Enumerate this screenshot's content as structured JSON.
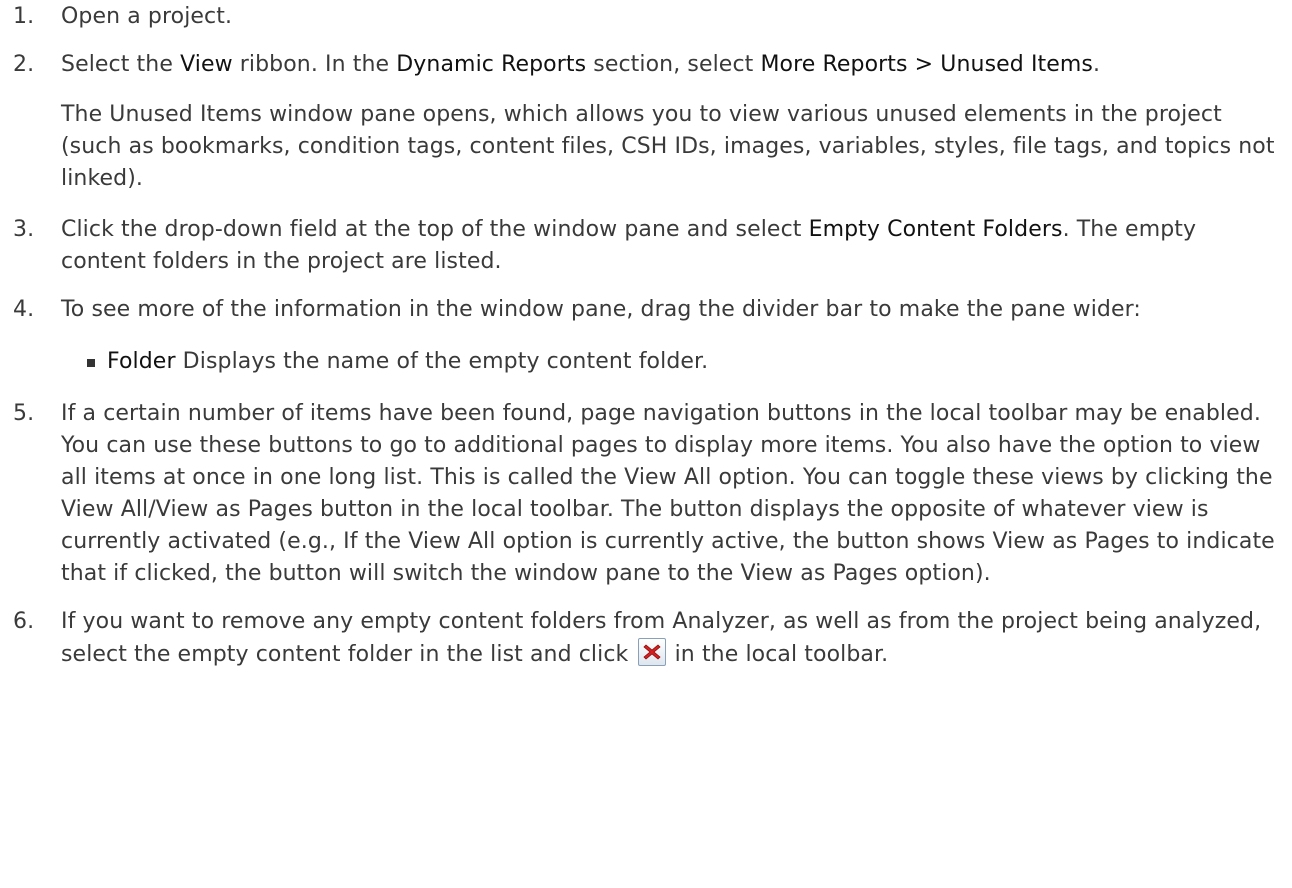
{
  "steps": [
    {
      "num": "1.",
      "text": "Open a project."
    },
    {
      "num": "2.",
      "t1": "Select the ",
      "ui1": "View",
      "t2": " ribbon. In the ",
      "ui2": "Dynamic Reports",
      "t3": " section, select ",
      "ui3": "More Reports > Unused Items",
      "t4": ".",
      "note": "The Unused Items window pane opens, which allows you to view various unused elements in the project (such as bookmarks, condition tags, content files, CSH IDs, images, variables, styles, file tags, and topics not linked)."
    },
    {
      "num": "3.",
      "t1": "Click the drop-down field at the top of the window pane and select ",
      "ui1": "Empty Content Folders",
      "t2": ". The empty content folders in the project are listed."
    },
    {
      "num": "4.",
      "text": "To see more of the information in the window pane, drag the divider bar to make the pane wider:",
      "bullet_term": "Folder",
      "bullet_text": " Displays the name of the empty content folder."
    },
    {
      "num": "5.",
      "text": "If a certain number of items have been found, page navigation buttons in the local toolbar may be enabled. You can use these buttons to go to additional pages to display more items. You also have the option to view all items at once in one long list. This is called the View All option. You can toggle these views by clicking the View All/View as Pages button in the local toolbar. The button displays the opposite of whatever view is currently activated (e.g., If the View All option is currently active, the button shows View as Pages to indicate that if clicked, the button will switch the window pane to the View as Pages option)."
    },
    {
      "num": "6.",
      "t1": "If you want to remove any empty content folders from Analyzer, as well as from the project being analyzed, select the empty content folder in the list and click ",
      "t2": " in the local toolbar."
    }
  ],
  "icons": {
    "delete": "delete-icon",
    "delete_color": "#d42020"
  }
}
